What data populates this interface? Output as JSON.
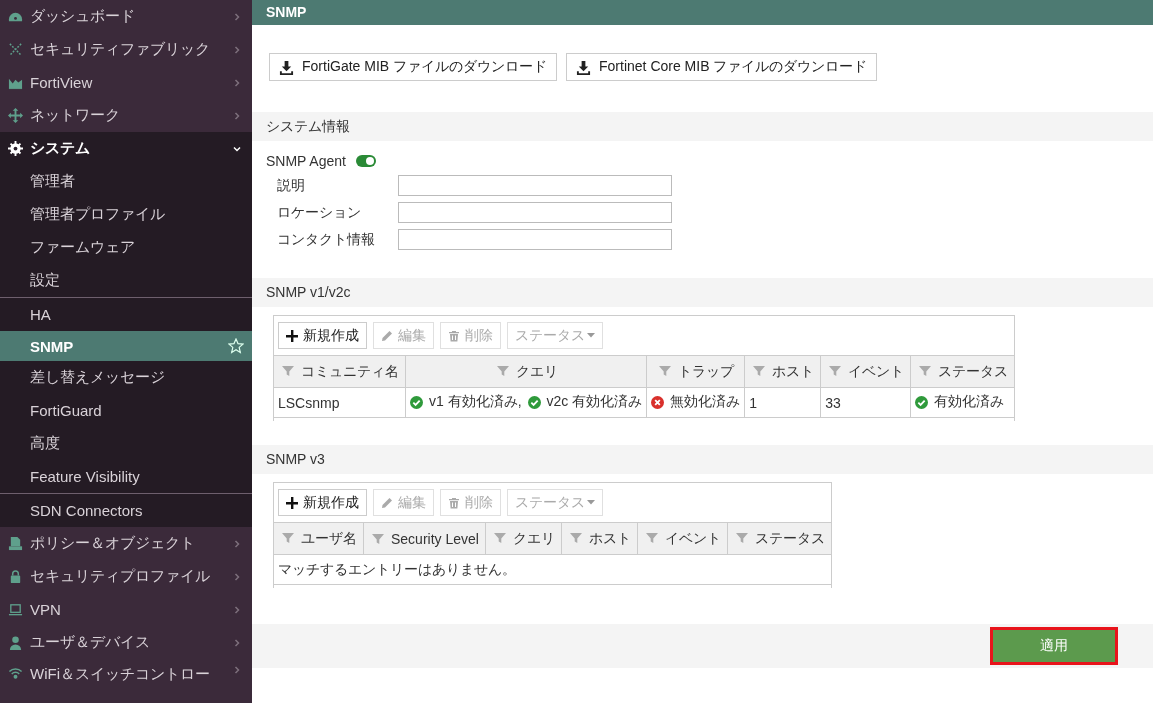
{
  "sidebar": {
    "items": [
      {
        "label": "ダッシュボード",
        "expanded": false
      },
      {
        "label": "セキュリティファブリック",
        "expanded": false
      },
      {
        "label": "FortiView",
        "expanded": false
      },
      {
        "label": "ネットワーク",
        "expanded": false
      },
      {
        "label": "システム",
        "expanded": true,
        "children": [
          {
            "label": "管理者",
            "selected": false,
            "group_end": false
          },
          {
            "label": "管理者プロファイル",
            "selected": false,
            "group_end": false
          },
          {
            "label": "ファームウェア",
            "selected": false,
            "group_end": false
          },
          {
            "label": "設定",
            "selected": false,
            "group_end": true
          },
          {
            "label": "HA",
            "selected": false,
            "group_end": false
          },
          {
            "label": "SNMP",
            "selected": true,
            "group_end": false
          },
          {
            "label": "差し替えメッセージ",
            "selected": false,
            "group_end": false
          },
          {
            "label": "FortiGuard",
            "selected": false,
            "group_end": false
          },
          {
            "label": "高度",
            "selected": false,
            "group_end": false
          },
          {
            "label": "Feature Visibility",
            "selected": false,
            "group_end": true
          },
          {
            "label": "SDN Connectors",
            "selected": false,
            "group_end": false
          }
        ]
      },
      {
        "label": "ポリシー＆オブジェクト",
        "expanded": false
      },
      {
        "label": "セキュリティプロファイル",
        "expanded": false
      },
      {
        "label": "VPN",
        "expanded": false
      },
      {
        "label": "ユーザ＆デバイス",
        "expanded": false
      },
      {
        "label": "WiFi＆スイッチコントロー",
        "expanded": false
      }
    ]
  },
  "page": {
    "title": "SNMP",
    "downloads": [
      "FortiGate MIB ファイルのダウンロード",
      "Fortinet Core MIB ファイルのダウンロード"
    ],
    "system_info": {
      "heading": "システム情報",
      "agent_label": "SNMP Agent",
      "agent_on": true,
      "fields": [
        {
          "label": "説明"
        },
        {
          "label": "ロケーション"
        },
        {
          "label": "コンタクト情報"
        }
      ]
    },
    "tables": [
      {
        "heading": "SNMP v1/v2c",
        "toolbar": [
          {
            "label": "新規作成",
            "kind": "new",
            "disabled": false
          },
          {
            "label": "編集",
            "kind": "edit",
            "disabled": true
          },
          {
            "label": "削除",
            "kind": "delete",
            "disabled": true
          },
          {
            "label": "ステータス",
            "kind": "status",
            "disabled": true
          }
        ],
        "columns": [
          "コミュニティ名",
          "クエリ",
          "トラップ",
          "ホスト",
          "イベント",
          "ステータス"
        ],
        "rows": [
          [
            [
              {
                "text": "LSCsnmp"
              }
            ],
            [
              {
                "text": "v1 有効化済み,",
                "kind": "ok"
              },
              {
                "text": "v2c 有効化済み",
                "kind": "ok"
              }
            ],
            [
              {
                "text": "無効化済み",
                "kind": "error"
              }
            ],
            [
              {
                "text": "1"
              }
            ],
            [
              {
                "text": "33"
              }
            ],
            [
              {
                "text": "有効化済み",
                "kind": "ok"
              }
            ]
          ]
        ]
      },
      {
        "heading": "SNMP v3",
        "toolbar": [
          {
            "label": "新規作成",
            "kind": "new",
            "disabled": false
          },
          {
            "label": "編集",
            "kind": "edit",
            "disabled": true
          },
          {
            "label": "削除",
            "kind": "delete",
            "disabled": true
          },
          {
            "label": "ステータス",
            "kind": "status",
            "disabled": true
          }
        ],
        "columns": [
          "ユーザ名",
          "Security Level",
          "クエリ",
          "ホスト",
          "イベント",
          "ステータス"
        ],
        "empty_message": "マッチするエントリーはありません。"
      }
    ],
    "apply": {
      "label": "適用",
      "highlighted": true
    }
  }
}
